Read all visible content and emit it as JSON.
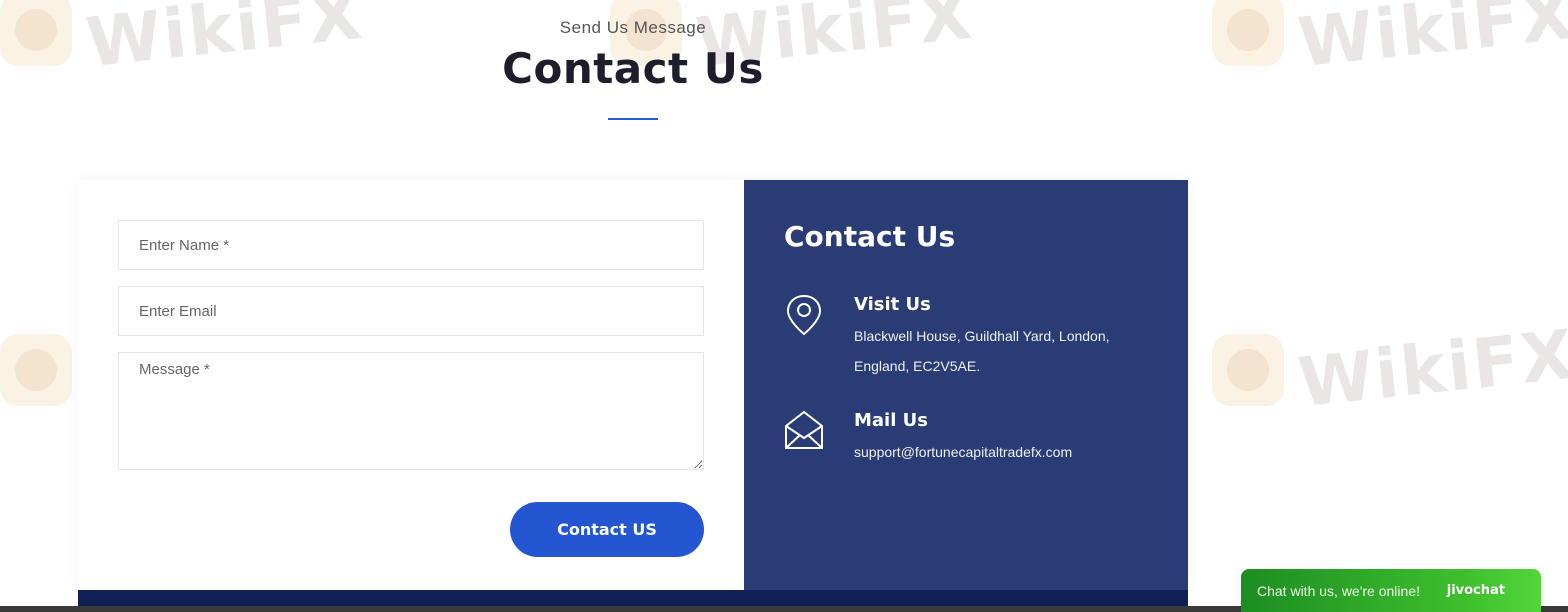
{
  "header": {
    "subtitle": "Send Us Message",
    "title": "Contact Us"
  },
  "form": {
    "name_placeholder": "Enter Name *",
    "email_placeholder": "Enter Email",
    "message_placeholder": "Message *",
    "submit_label": "Contact US"
  },
  "info": {
    "title": "Contact Us",
    "visit": {
      "heading": "Visit Us",
      "text": "Blackwell House, Guildhall Yard, London, England, EC2V5AE.",
      "icon": "location-pin-icon"
    },
    "mail": {
      "heading": "Mail Us",
      "text": "support@fortunecapitaltradefx.com",
      "icon": "envelope-icon"
    }
  },
  "chat": {
    "text": "Chat with us, we're online!",
    "brand": "jivochat"
  },
  "watermark": {
    "text": "WikiFX"
  },
  "colors": {
    "accent": "#2556d1",
    "info_panel": "#2a3c76",
    "footer": "#101f55",
    "chat": "#3fbf2e"
  }
}
